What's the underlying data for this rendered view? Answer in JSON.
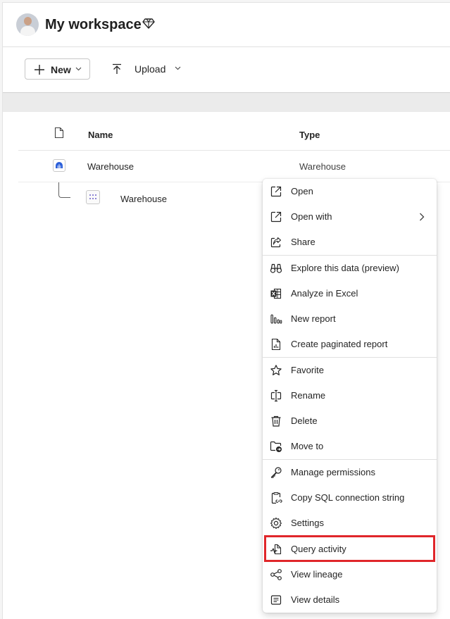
{
  "header": {
    "title": "My workspace"
  },
  "toolbar": {
    "new_label": "New",
    "upload_label": "Upload"
  },
  "table": {
    "columns": {
      "name": "Name",
      "type": "Type"
    },
    "rows": [
      {
        "name": "Warehouse",
        "type": "Warehouse"
      },
      {
        "name": "Warehouse",
        "type": ""
      }
    ]
  },
  "context_menu": {
    "items": [
      {
        "label": "Open",
        "icon": "open-icon"
      },
      {
        "label": "Open with",
        "icon": "open-with-icon"
      },
      {
        "label": "Share",
        "icon": "share-icon"
      },
      {
        "label": "Explore this data (preview)",
        "icon": "binoculars-icon"
      },
      {
        "label": "Analyze in Excel",
        "icon": "excel-icon"
      },
      {
        "label": "New report",
        "icon": "bar-chart-icon"
      },
      {
        "label": "Create paginated report",
        "icon": "paginated-report-icon"
      },
      {
        "label": "Favorite",
        "icon": "star-icon"
      },
      {
        "label": "Rename",
        "icon": "rename-icon"
      },
      {
        "label": "Delete",
        "icon": "trash-icon"
      },
      {
        "label": "Move to",
        "icon": "move-folder-icon"
      },
      {
        "label": "Manage permissions",
        "icon": "key-icon"
      },
      {
        "label": "Copy SQL connection string",
        "icon": "clipboard-link-icon"
      },
      {
        "label": "Settings",
        "icon": "gear-icon"
      },
      {
        "label": "Query activity",
        "icon": "query-activity-icon"
      },
      {
        "label": "View lineage",
        "icon": "lineage-icon"
      },
      {
        "label": "View details",
        "icon": "details-icon"
      }
    ]
  },
  "colors": {
    "highlight": "#e0262a",
    "warehouse_icon": "#2b5fd9",
    "text": "#242424"
  }
}
